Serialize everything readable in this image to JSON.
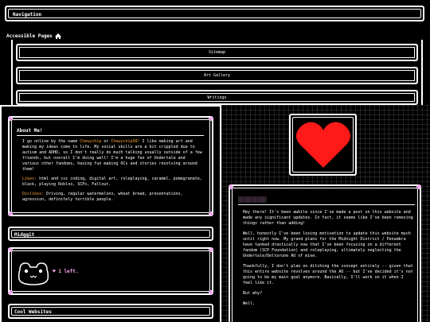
{
  "nav": {
    "title": "Navigation",
    "accessible_heading": "Accessible Pages",
    "home_icon": "home-icon",
    "links": [
      "Sitemap",
      "Art Gallery",
      "Writings"
    ]
  },
  "about": {
    "title": "About Me!",
    "p1_pre": "I go online by the name ",
    "name1": "Chewychip",
    "p1_mid": " or ",
    "name2": "Chewychip98!",
    "p1_post": " I like making art and making my ideas come to life. My social skills are a bit crippled due to autism and ADHD, so I don't really do much talking usually outside of a few friends, but overall I'm doing well! I'm a huge fan of Undertale and various other fandoms, having fun making OCs and stories revolving around them!",
    "likes_label": "Likes:",
    "likes_text": " html and css coding, digital art, roleplaying, caramel, pomegranate, black, playing Roblox, SCPs, Fallout.",
    "dislikes_label": "Dislikes:",
    "dislikes_text": " Driving, regular watermelons, wheat bread, presentations, agression, definitely terrible people."
  },
  "midggit": {
    "title": "Midggit",
    "status": "♥ 1 left."
  },
  "cool": {
    "title": "Cool Websites"
  },
  "blog": {
    "tag": "░░░░░░░░░░",
    "p1": "Hey there! It's been awhile since I've made a post on this website and made any significant updates. In fact, it seems like I've been removing things rather than adding!",
    "p2": "Well, honestly I've been losing motivation to update this website much until right now. My grand plans for the Midnight District / Penumbra have tanked drastically now that I've been focusing on a different fandom (SCP Foundation) and roleplaying, ultimately neglecting the Undertale/Deltarune AU of mine.",
    "p3": "Thankfully, I don't plan on ditching the concept entirely -- given that this entire website revolves around the AU -- but I've decided it's not going to be my main goal anymore. Basically, I'll work on it when I feel like it.",
    "p4": "But why?",
    "p5": "Well,"
  },
  "colors": {
    "accent_orange": "#f2a03c",
    "accent_pink": "#f4a6e7",
    "heart": "#ff1a1a"
  }
}
